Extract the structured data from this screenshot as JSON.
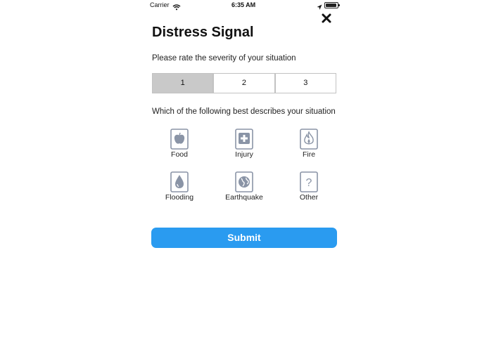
{
  "status_bar": {
    "carrier": "Carrier",
    "time": "6:35 AM",
    "battery_level": 0.95
  },
  "close": {
    "icon": "close-icon"
  },
  "title": "Distress Signal",
  "severity": {
    "prompt": "Please rate the severity of your situation",
    "options": [
      "1",
      "2",
      "3"
    ],
    "selected": "1"
  },
  "situation": {
    "prompt": "Which of the following best describes your situation",
    "categories": [
      {
        "label": "Food",
        "icon": "apple-icon"
      },
      {
        "label": "Injury",
        "icon": "first-aid-icon"
      },
      {
        "label": "Fire",
        "icon": "fire-icon"
      },
      {
        "label": "Flooding",
        "icon": "water-drop-icon"
      },
      {
        "label": "Earthquake",
        "icon": "globe-icon"
      },
      {
        "label": "Other",
        "icon": "question-icon"
      }
    ]
  },
  "submit_label": "Submit",
  "colors": {
    "accent": "#2a9bf0",
    "selected_segment": "#c9c9c9",
    "icon_gray": "#8a94a6"
  }
}
